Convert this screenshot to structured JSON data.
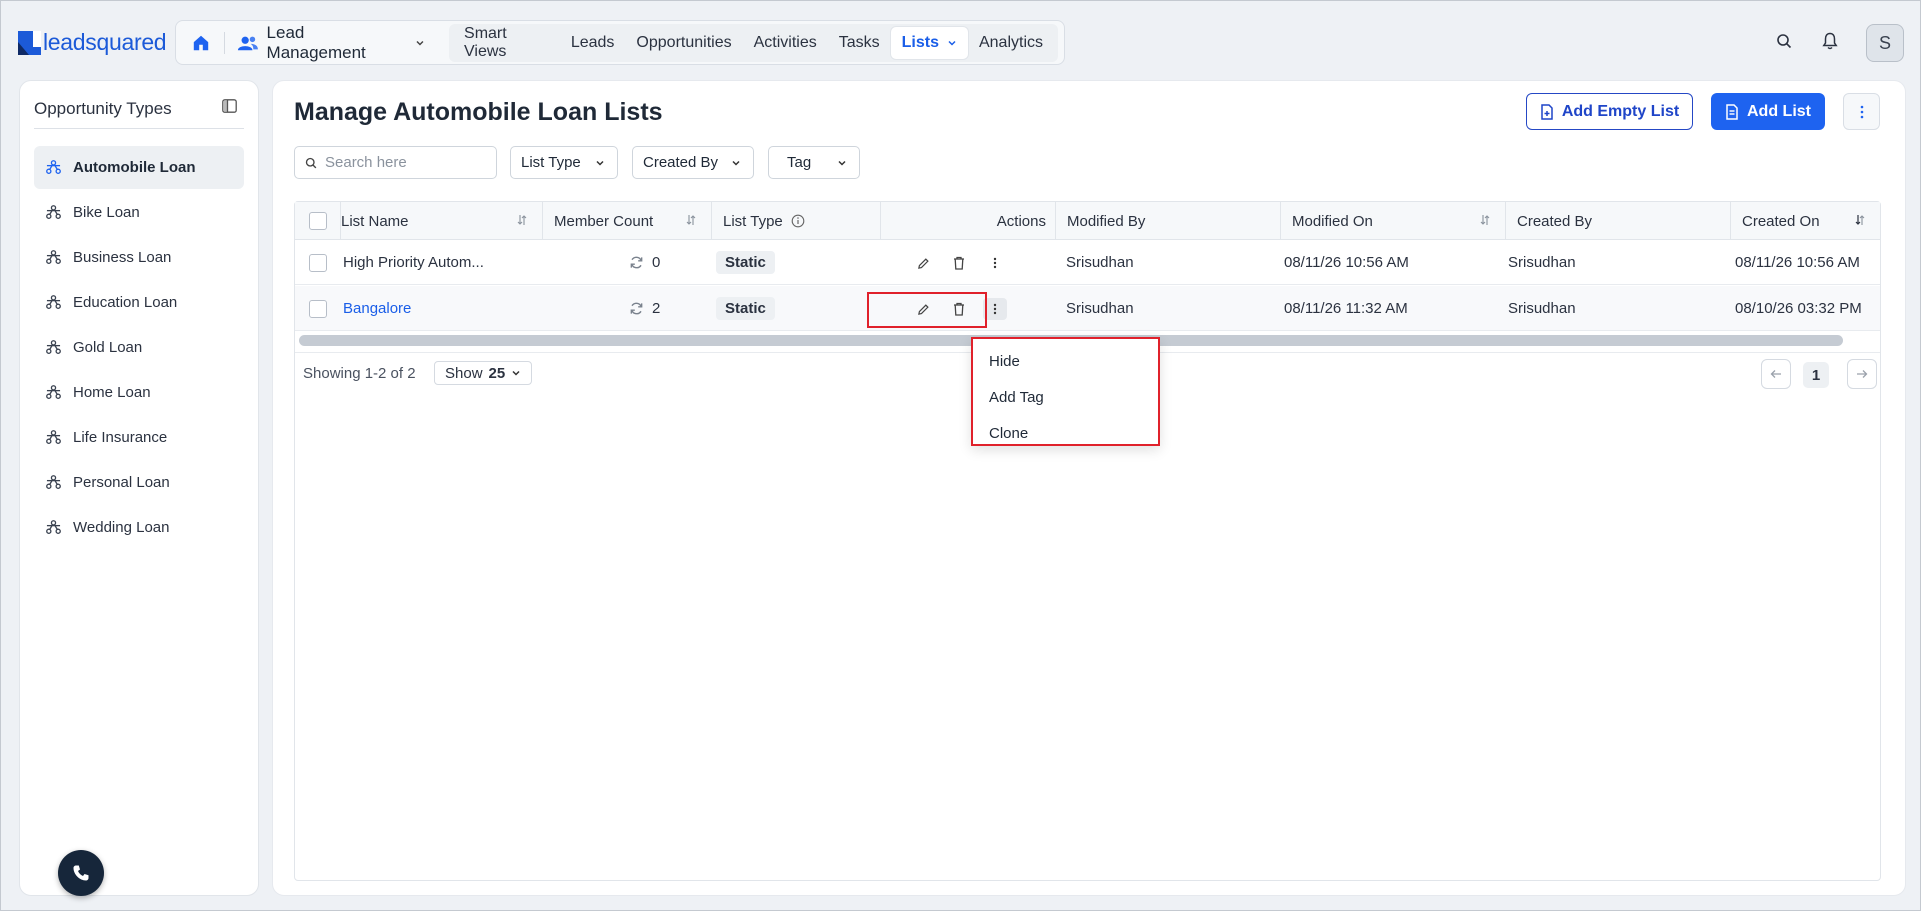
{
  "brand": {
    "name": "leadsquared",
    "color": "#1c5ad8"
  },
  "nav": {
    "module": "Lead Management",
    "items": [
      {
        "label": "Smart Views"
      },
      {
        "label": "Leads"
      },
      {
        "label": "Opportunities"
      },
      {
        "label": "Activities"
      },
      {
        "label": "Tasks"
      },
      {
        "label": "Lists",
        "active": true
      },
      {
        "label": "Analytics"
      }
    ]
  },
  "user": {
    "initial": "S"
  },
  "sidebar": {
    "title": "Opportunity Types",
    "items": [
      {
        "label": "Automobile Loan",
        "active": true
      },
      {
        "label": "Bike Loan"
      },
      {
        "label": "Business Loan"
      },
      {
        "label": "Education Loan"
      },
      {
        "label": "Gold Loan"
      },
      {
        "label": "Home Loan"
      },
      {
        "label": "Life Insurance"
      },
      {
        "label": "Personal Loan"
      },
      {
        "label": "Wedding Loan"
      }
    ]
  },
  "main": {
    "title": "Manage Automobile Loan Lists",
    "add_empty_list": "Add Empty List",
    "add_list": "Add List",
    "search_placeholder": "Search here",
    "filters": {
      "list_type": "List Type",
      "created_by": "Created By",
      "tag": "Tag"
    }
  },
  "table": {
    "columns": {
      "list_name": "List Name",
      "member_count": "Member Count",
      "list_type": "List Type",
      "actions": "Actions",
      "modified_by": "Modified By",
      "modified_on": "Modified On",
      "created_by": "Created By",
      "created_on": "Created On"
    },
    "rows": [
      {
        "name": "High Priority Autom...",
        "count": "0",
        "type": "Static",
        "modified_by": "Srisudhan",
        "modified_on": "08/11/26 10:56 AM",
        "created_by": "Srisudhan",
        "created_on": "08/11/26 10:56 AM"
      },
      {
        "name": "Bangalore",
        "count": "2",
        "type": "Static",
        "modified_by": "Srisudhan",
        "modified_on": "08/11/26 11:32 AM",
        "created_by": "Srisudhan",
        "created_on": "08/10/26 03:32 PM"
      }
    ]
  },
  "footer": {
    "showing": "Showing 1-2 of 2",
    "show_label": "Show",
    "page_size": "25",
    "current_page": "1"
  },
  "row_menu": {
    "items": [
      {
        "label": "Hide"
      },
      {
        "label": "Add Tag"
      },
      {
        "label": "Clone"
      }
    ]
  },
  "colors": {
    "accent": "#1e63f0",
    "highlight": "#e0212b"
  }
}
